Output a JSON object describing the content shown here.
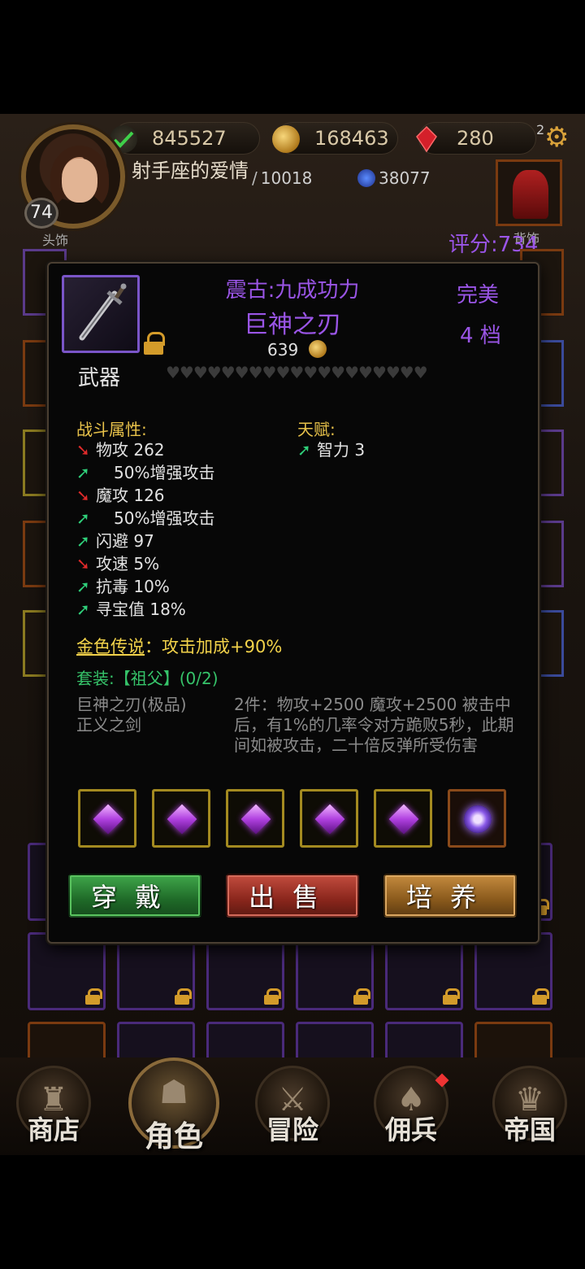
{
  "hud": {
    "resource_wreath_value": "845527",
    "resource_gold_value": "168463",
    "resource_gem_value": "280",
    "gear_badge_number": "2",
    "player_level": "74",
    "player_name": "射手座的爱情",
    "head_slot_label": "头饰",
    "attack_power": "10018",
    "magic_power": "38077",
    "back_slot_label": "背饰",
    "score_label": "评分:734"
  },
  "item": {
    "prefix": "震古:九成功力",
    "name": "巨神之刃",
    "price": "639",
    "type_label": "武器",
    "quality": "完美",
    "grade": "4 档",
    "hearts": "♥♥♥♥♥♥♥♥♥♥♥♥♥♥♥♥♥♥♥",
    "combat_title": "战斗属性:",
    "talent_title": "天赋:",
    "combat_attrs": [
      {
        "arrow": "down",
        "text": "物攻 262"
      },
      {
        "arrow": "up",
        "text": "50%增强攻击",
        "indent": true
      },
      {
        "arrow": "down",
        "text": "魔攻 126"
      },
      {
        "arrow": "up",
        "text": "50%增强攻击",
        "indent": true
      },
      {
        "arrow": "up",
        "text": "闪避 97"
      },
      {
        "arrow": "down",
        "text": "攻速 5%"
      },
      {
        "arrow": "up",
        "text": "抗毒 10%"
      },
      {
        "arrow": "up",
        "text": "寻宝值 18%"
      }
    ],
    "talent_attrs": [
      {
        "arrow": "up",
        "text": "智力 3"
      }
    ],
    "legend_prefix": "金色传说",
    "legend_text": "：攻击加成+90%",
    "set_line": "套装:【祖父】(0/2)",
    "set_item_1": "巨神之刃(极品)",
    "set_item_2": "正义之剑",
    "set_bonus": "2件：物攻+2500 魔攻+2500 被击中后，有1%的几率令对方跪败5秒，此期间如被攻击，二十倍反弹所受伤害",
    "gem_slots": [
      "purple-diamond",
      "purple-diamond",
      "purple-diamond",
      "purple-diamond",
      "purple-diamond",
      "purple-hexagon"
    ]
  },
  "buttons": {
    "equip": "穿戴",
    "sell": "出售",
    "cultivate": "培养"
  },
  "nav": {
    "shop": "商店",
    "character": "角色",
    "adventure": "冒险",
    "mercenary": "佣兵",
    "empire": "帝国"
  },
  "colors": {
    "epic_purple": "#9a55e6",
    "gold_text": "#e8c24a",
    "set_green": "#36c46a",
    "up_arrow": "#2fd07a",
    "down_arrow": "#e02a2a"
  }
}
